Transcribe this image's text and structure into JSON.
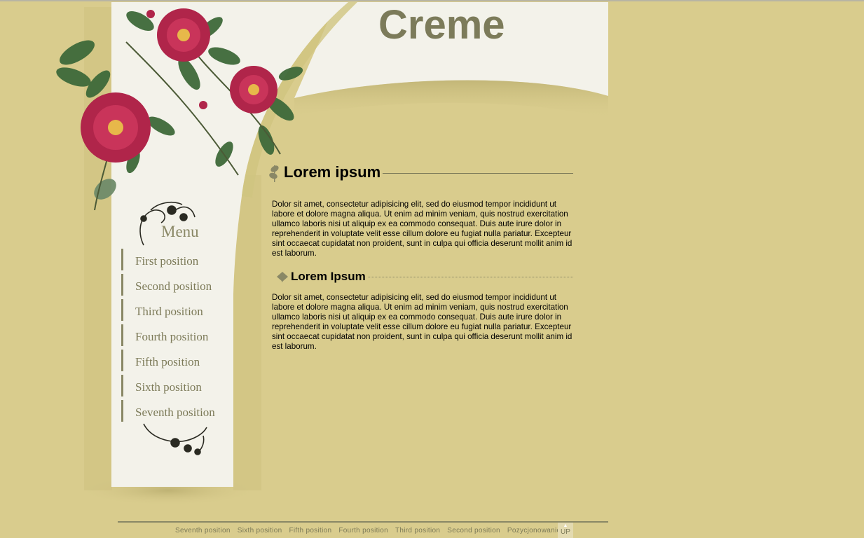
{
  "header": {
    "site_title": "Creme"
  },
  "menu": {
    "heading": "Menu",
    "items": [
      {
        "label": "First position"
      },
      {
        "label": "Second position"
      },
      {
        "label": "Third position"
      },
      {
        "label": "Fourth position"
      },
      {
        "label": "Fifth position"
      },
      {
        "label": "Sixth position"
      },
      {
        "label": "Seventh position"
      }
    ]
  },
  "content": {
    "heading1": "Lorem ipsum",
    "paragraph1": "Dolor sit amet, consectetur adipisicing elit, sed do eiusmod tempor incididunt ut labore et dolore magna aliqua. Ut enim ad minim veniam, quis nostrud exercitation ullamco laboris nisi ut aliquip ex ea commodo consequat. Duis aute irure dolor in reprehenderit in voluptate velit esse cillum dolore eu fugiat nulla pariatur. Excepteur sint occaecat cupidatat non proident, sunt in culpa qui officia deserunt mollit anim id est laborum.",
    "heading2": "Lorem Ipsum",
    "paragraph2": "Dolor sit amet, consectetur adipisicing elit, sed do eiusmod tempor incididunt ut labore et dolore magna aliqua. Ut enim ad minim veniam, quis nostrud exercitation ullamco laboris nisi ut aliquip ex ea commodo consequat. Duis aute irure dolor in reprehenderit in voluptate velit esse cillum dolore eu fugiat nulla pariatur. Excepteur sint occaecat cupidatat non proident, sunt in culpa qui officia deserunt mollit anim id est laborum."
  },
  "footer": {
    "links": [
      {
        "label": "Seventh position"
      },
      {
        "label": "Sixth position"
      },
      {
        "label": "Fifth position"
      },
      {
        "label": "Fourth position"
      },
      {
        "label": "Third position"
      },
      {
        "label": "Second position"
      },
      {
        "label": "Pozycjonowanie"
      }
    ],
    "up_label": "UP"
  },
  "colors": {
    "background": "#d9cc8d",
    "panel": "#f3f2ea",
    "accent": "#7c7a58",
    "rose": "#b0254a",
    "leaf": "#3e6a3a"
  },
  "icons": [
    "rose-bouquet-decoration",
    "menu-ornament-icon",
    "menu-footer-ornament-icon",
    "leaf-bullet-icon",
    "leaf-small-bullet-icon",
    "up-arrow-icon"
  ]
}
